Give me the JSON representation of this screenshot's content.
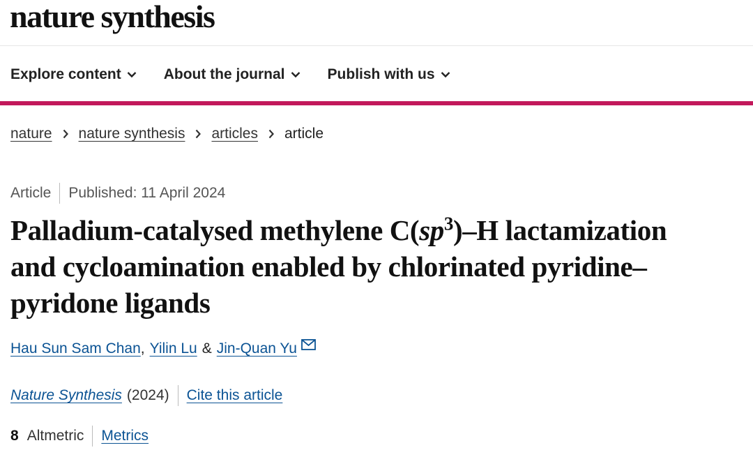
{
  "site": {
    "logo": "nature synthesis"
  },
  "colors": {
    "accent": "#c2185b",
    "link": "#0b5394"
  },
  "nav": {
    "items": [
      {
        "label": "Explore content",
        "icon": "chevron-down-icon"
      },
      {
        "label": "About the journal",
        "icon": "chevron-down-icon"
      },
      {
        "label": "Publish with us",
        "icon": "chevron-down-icon"
      }
    ]
  },
  "breadcrumb": {
    "items": [
      "nature",
      "nature synthesis",
      "articles"
    ],
    "current": "article",
    "separator_icon": "chevron-right-icon"
  },
  "article": {
    "type": "Article",
    "published": "Published: 11 April 2024",
    "title_parts": {
      "before": "Palladium-catalysed methylene C(",
      "italic": "sp",
      "superscript": "3",
      "after": ")–H lactamization and cycloamination enabled by chlorinated pyridine–pyridone ligands"
    },
    "authors": [
      {
        "name": "Hau Sun Sam Chan"
      },
      {
        "name": "Yilin Lu"
      },
      {
        "name": "Jin-Quan Yu",
        "icon": "mail-icon"
      }
    ],
    "author_comma": ",",
    "author_amp": "&",
    "journal": "Nature Synthesis",
    "year": "(2024)",
    "cite_label": "Cite this article",
    "altmetric_value": "8",
    "altmetric_label": "Altmetric",
    "metrics_label": "Metrics"
  }
}
